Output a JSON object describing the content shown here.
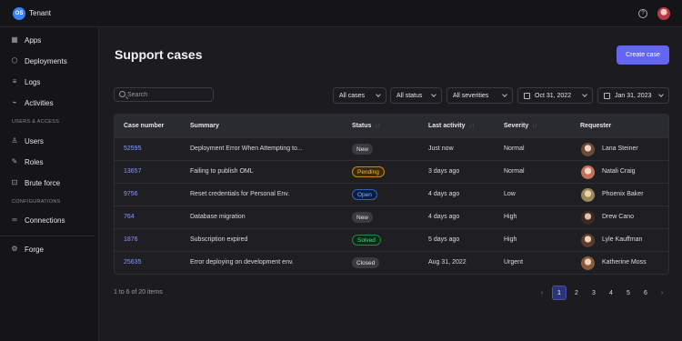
{
  "topbar": {
    "logo_text": "OS",
    "tenant": "Tenant"
  },
  "sidebar": {
    "items": [
      {
        "label": "Apps",
        "icon": "grid-icon"
      },
      {
        "label": "Deployments",
        "icon": "cube-icon"
      },
      {
        "label": "Logs",
        "icon": "logs-icon"
      },
      {
        "label": "Activities",
        "icon": "activity-icon"
      }
    ],
    "section_users": "USERS & ACCESS",
    "users_items": [
      {
        "label": "Users",
        "icon": "user-icon"
      },
      {
        "label": "Roles",
        "icon": "pencil-icon"
      },
      {
        "label": "Brute force",
        "icon": "lock-icon"
      }
    ],
    "section_config": "CONFIGURATIONS",
    "config_items": [
      {
        "label": "Connections",
        "icon": "link-icon"
      }
    ],
    "forge": {
      "label": "Forge",
      "icon": "gear-icon"
    }
  },
  "page": {
    "title": "Support cases",
    "create_button": "Create case"
  },
  "search": {
    "placeholder": "Search"
  },
  "filters": {
    "cases": "All cases",
    "status": "All status",
    "severities": "All severities",
    "date_from": "Oct 31, 2022",
    "date_to": "Jan 31, 2023"
  },
  "table": {
    "headers": {
      "case": "Case number",
      "summary": "Summary",
      "status": "Status",
      "activity": "Last activity",
      "severity": "Severity",
      "requester": "Requester"
    },
    "rows": [
      {
        "case": "52595",
        "summary": "Deployment Error When Attempting to...",
        "status": "New",
        "activity": "Just now",
        "severity": "Normal",
        "requester": "Lana Steiner"
      },
      {
        "case": "13657",
        "summary": "Failing to publish OML",
        "status": "Pending",
        "activity": "3 days ago",
        "severity": "Normal",
        "requester": "Natali Craig"
      },
      {
        "case": "9756",
        "summary": "Reset credentials for Personal Env.",
        "status": "Open",
        "activity": "4 days ago",
        "severity": "Low",
        "requester": "Phoenix Baker"
      },
      {
        "case": "764",
        "summary": "Database migration",
        "status": "New",
        "activity": "4 days ago",
        "severity": "High",
        "requester": "Drew Cano"
      },
      {
        "case": "1876",
        "summary": "Subscription expired",
        "status": "Solved",
        "activity": "5 days ago",
        "severity": "High",
        "requester": "Lyle Kauffman"
      },
      {
        "case": "25635",
        "summary": "Error deploying on development env.",
        "status": "Closed",
        "activity": "Aug 31, 2022",
        "severity": "Urgent",
        "requester": "Katherine Moss"
      }
    ]
  },
  "pagination": {
    "summary": "1 to 6 of 20 items",
    "pages": [
      "1",
      "2",
      "3",
      "4",
      "5",
      "6"
    ],
    "current": "1",
    "prev": "‹",
    "next": "›"
  }
}
